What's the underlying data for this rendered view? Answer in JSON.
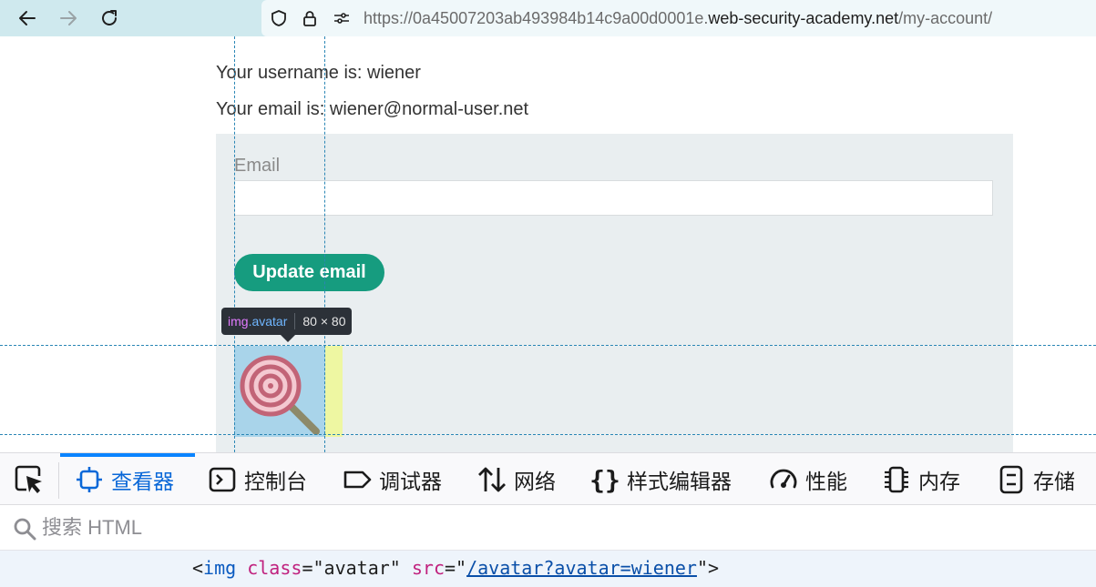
{
  "browser": {
    "url_prefix": "https://0a45007203ab493984b14c9a00d0001e.",
    "url_host": "web-security-academy.net",
    "url_path": "/my-account/",
    "icons": [
      "back-icon",
      "forward-icon",
      "reload-icon",
      "shield-icon",
      "lock-icon",
      "permissions-icon"
    ]
  },
  "page": {
    "username_line": "Your username is: wiener",
    "email_line": "Your email is: wiener@normal-user.net",
    "email_label": "Email",
    "email_value": "",
    "update_button": "Update email"
  },
  "inspector_tooltip": {
    "tag": "img",
    "class": ".avatar",
    "dims": "80 × 80"
  },
  "devtools": {
    "tabs": [
      {
        "label": "查看器",
        "icon": "inspector-icon",
        "active": true
      },
      {
        "label": "控制台",
        "icon": "console-icon",
        "active": false
      },
      {
        "label": "调试器",
        "icon": "debugger-icon",
        "active": false
      },
      {
        "label": "网络",
        "icon": "network-icon",
        "active": false
      },
      {
        "label": "样式编辑器",
        "icon": "style-editor-icon",
        "active": false
      },
      {
        "label": "性能",
        "icon": "performance-icon",
        "active": false
      },
      {
        "label": "内存",
        "icon": "memory-icon",
        "active": false
      },
      {
        "label": "存储",
        "icon": "storage-icon",
        "active": false
      }
    ],
    "search_placeholder": "搜索 HTML",
    "html_node": {
      "open": "<",
      "tag": "img",
      "attr1_name": "class",
      "attr1_value": "\"avatar\"",
      "attr2_name": "src",
      "attr2_value": "/avatar?avatar=wiener",
      "close": ">"
    }
  },
  "colors": {
    "toolbar_bg": "#cfe9ee",
    "button_green": "#169c7f",
    "panel_bg": "#e9eef0",
    "highlight_blue": "#a9d4ea",
    "highlight_yellow": "#eef7a2",
    "devtools_accent": "#0a84ff"
  }
}
